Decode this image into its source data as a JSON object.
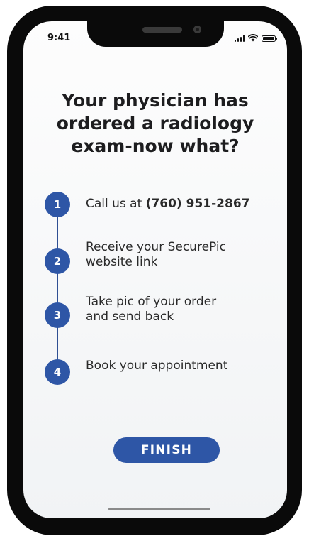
{
  "status_bar": {
    "time": "9:41",
    "icons": [
      "signal-icon",
      "wifi-icon",
      "battery-icon"
    ]
  },
  "headline": {
    "lines": [
      "Your physician has",
      "ordered a radiology",
      "exam-now what?"
    ]
  },
  "steps": [
    {
      "number": "1",
      "text_prefix": "Call us at ",
      "phone": "(760) 951-2867"
    },
    {
      "number": "2",
      "lines": [
        "Receive your SecurePic",
        "website link"
      ]
    },
    {
      "number": "3",
      "lines": [
        "Take pic of your order",
        "and send back"
      ]
    },
    {
      "number": "4",
      "lines": [
        "Book your appointment"
      ]
    }
  ],
  "finish_button": {
    "label": "FINISH"
  },
  "colors": {
    "accent": "#2e56a6",
    "timeline": "#2f4f93",
    "text": "#1d1d1f",
    "frame": "#0a0a0a"
  }
}
